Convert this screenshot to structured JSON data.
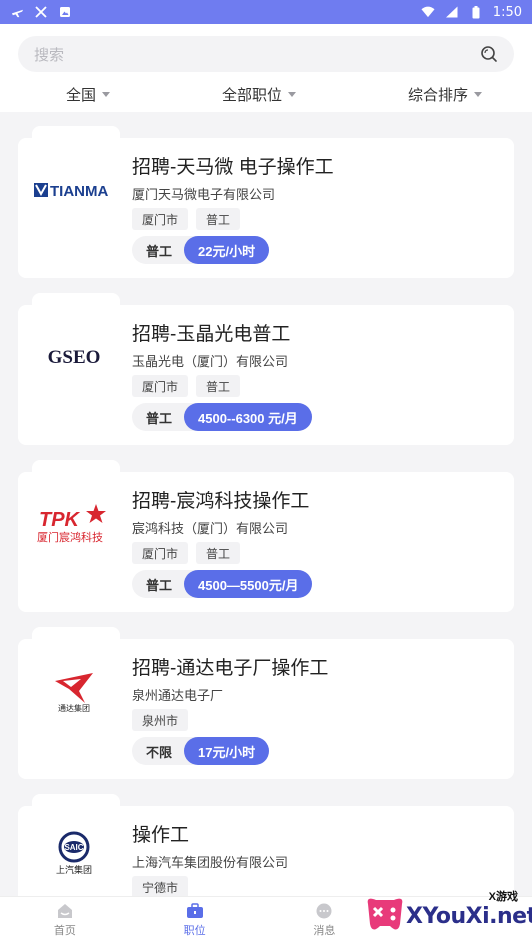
{
  "status_bar": {
    "time": "1:50"
  },
  "search": {
    "placeholder": "搜索"
  },
  "filters": [
    {
      "label": "全国"
    },
    {
      "label": "全部职位"
    },
    {
      "label": "综合排序"
    }
  ],
  "jobs": [
    {
      "title": "招聘-天马微 电子操作工",
      "company": "厦门天马微电子有限公司",
      "tags": [
        "厦门市",
        "普工"
      ],
      "type": "普工",
      "pay": "22元/小时",
      "logo_text": "TIANMA"
    },
    {
      "title": "招聘-玉晶光电普工",
      "company": "玉晶光电（厦门）有限公司",
      "tags": [
        "厦门市",
        "普工"
      ],
      "type": "普工",
      "pay": "4500--6300 元/月",
      "logo_text": "GSEO"
    },
    {
      "title": "招聘-宸鸿科技操作工",
      "company": "宸鸿科技（厦门）有限公司",
      "tags": [
        "厦门市",
        "普工"
      ],
      "type": "普工",
      "pay": "4500—5500元/月",
      "logo_text": "TPK",
      "logo_sub": "厦门宸鸿科技"
    },
    {
      "title": "招聘-通达电子厂操作工",
      "company": "泉州通达电子厂",
      "tags": [
        "泉州市"
      ],
      "type": "不限",
      "pay": "17元/小时",
      "logo_text": "通达集团"
    },
    {
      "title": "操作工",
      "company": "上海汽车集团股份有限公司",
      "tags": [
        "宁德市"
      ],
      "logo_text": "SAIC",
      "logo_sub": "上汽集团"
    }
  ],
  "tabbar": [
    {
      "label": "首页"
    },
    {
      "label": "职位"
    },
    {
      "label": "消息"
    }
  ],
  "watermark": {
    "main": "XYouXi.net",
    "sub": "X游戏"
  },
  "colors": {
    "accent": "#5a6ee8",
    "status_bar": "#6f7cf0",
    "tpk_red": "#d8262f",
    "tianma_blue": "#1b3f8f"
  }
}
